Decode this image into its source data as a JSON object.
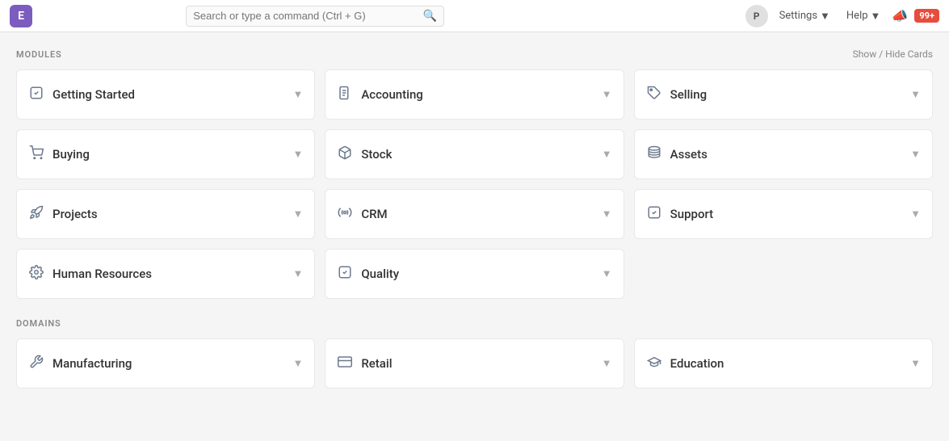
{
  "topbar": {
    "app_letter": "E",
    "search_placeholder": "Search or type a command (Ctrl + G)",
    "avatar_letter": "P",
    "settings_label": "Settings",
    "help_label": "Help",
    "badge_count": "99+"
  },
  "modules_section": {
    "label": "MODULES",
    "show_hide_label": "Show / Hide Cards",
    "cards": [
      {
        "id": "getting-started",
        "label": "Getting Started",
        "icon": "✔️",
        "icon_type": "check"
      },
      {
        "id": "accounting",
        "label": "Accounting",
        "icon": "📄",
        "icon_type": "doc"
      },
      {
        "id": "selling",
        "label": "Selling",
        "icon": "🏷️",
        "icon_type": "tag"
      },
      {
        "id": "buying",
        "label": "Buying",
        "icon": "🛒",
        "icon_type": "cart"
      },
      {
        "id": "stock",
        "label": "Stock",
        "icon": "📦",
        "icon_type": "box"
      },
      {
        "id": "assets",
        "label": "Assets",
        "icon": "🗄️",
        "icon_type": "stack"
      },
      {
        "id": "projects",
        "label": "Projects",
        "icon": "🚀",
        "icon_type": "rocket"
      },
      {
        "id": "crm",
        "label": "CRM",
        "icon": "📡",
        "icon_type": "signal"
      },
      {
        "id": "support",
        "label": "Support",
        "icon": "✔️",
        "icon_type": "check"
      },
      {
        "id": "human-resources",
        "label": "Human Resources",
        "icon": "⚙️",
        "icon_type": "cog"
      },
      {
        "id": "quality",
        "label": "Quality",
        "icon": "✔️",
        "icon_type": "check"
      },
      {
        "id": "empty",
        "label": "",
        "icon": "",
        "icon_type": "empty"
      }
    ]
  },
  "domains_section": {
    "label": "DOMAINS",
    "cards": [
      {
        "id": "manufacturing",
        "label": "Manufacturing",
        "icon": "🔧",
        "icon_type": "wrench"
      },
      {
        "id": "retail",
        "label": "Retail",
        "icon": "💳",
        "icon_type": "card"
      },
      {
        "id": "education",
        "label": "Education",
        "icon": "🎓",
        "icon_type": "cap"
      }
    ]
  }
}
